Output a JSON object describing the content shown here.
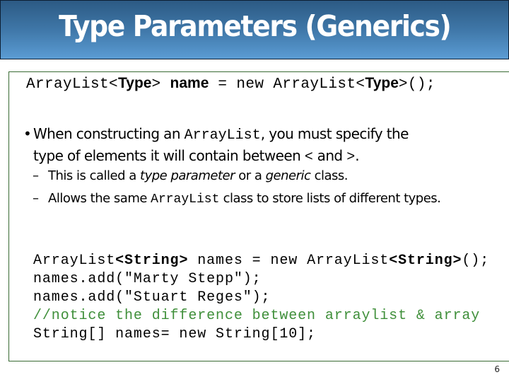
{
  "slide": {
    "title": "Type Parameters (Generics)",
    "page_number": "6",
    "colors": {
      "header_top": "#2c5a84",
      "header_bottom": "#5b9cd4",
      "box_border": "#3a6b34",
      "comment": "#3f8f3a"
    }
  },
  "syntax": {
    "part1": "ArrayList<",
    "type1": "Type",
    "part2": "> ",
    "name": "name",
    "part3": " = new ArrayList<",
    "type2": "Type",
    "part4": ">();"
  },
  "bullet": {
    "icon": "bullet-dot",
    "text1": "When constructing an ",
    "code1": "ArrayList",
    "text2": ", you must specify the",
    "text3": "type of elements it will contain between ",
    "lt": "<",
    "and": " and ",
    "gt": ">",
    "end": "."
  },
  "subbullets": [
    {
      "icon": "dash",
      "text1": "This is called a ",
      "em1": "type parameter",
      "text2": " or a ",
      "em2": "generic",
      "text3": " class."
    },
    {
      "icon": "dash",
      "text1": "Allows the same ",
      "code1": "ArrayList",
      "text2": " class to store lists of different types."
    }
  ],
  "code": {
    "line1_a": "ArrayList",
    "line1_b": "<String>",
    "line1_c": " names = new ArrayList",
    "line1_d": "<String>",
    "line1_e": "();",
    "line2": "names.add(\"Marty Stepp\");",
    "line3": "names.add(\"Stuart Reges\");",
    "line4": "//notice the difference between arraylist & array",
    "line5": "String[] names= new String[10];"
  }
}
